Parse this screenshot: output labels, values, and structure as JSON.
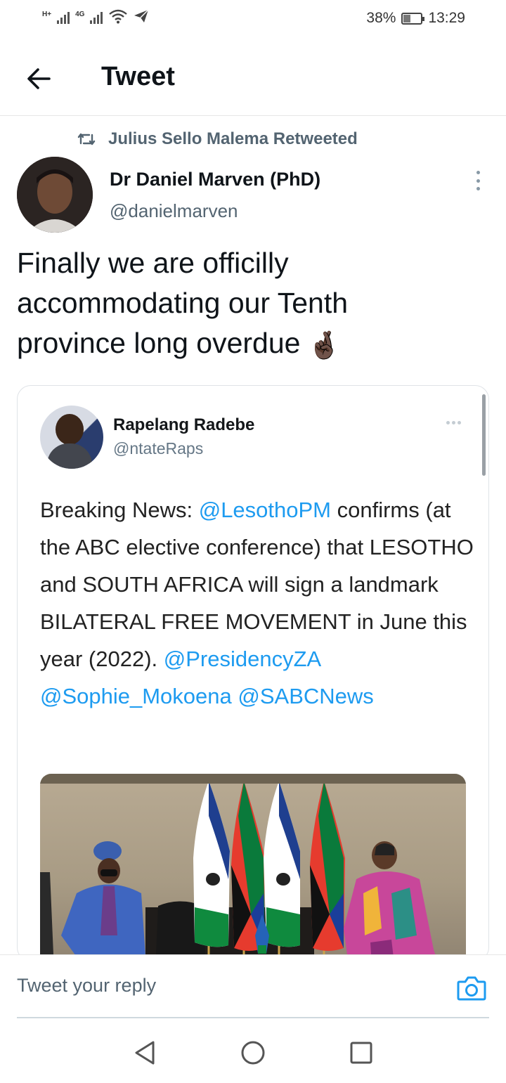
{
  "status_bar": {
    "network_1": "H+",
    "network_2": "4G",
    "battery_percent": "38%",
    "battery_level": 0.38,
    "time": "13:29"
  },
  "header": {
    "title": "Tweet",
    "back_icon": "arrow-left-icon"
  },
  "tweet": {
    "retweeted_by": "Julius Sello Malema Retweeted",
    "author_name": "Dr Daniel Marven (PhD)",
    "author_handle": "@danielmarven",
    "text": "Finally we are officilly accommodating our Tenth province long overdue",
    "emoji": "🤞🏿"
  },
  "quoted_screenshot": {
    "name": "Rapelang Radebe",
    "handle": "@ntateRaps",
    "text_parts": [
      {
        "text": "Breaking News: ",
        "link": false
      },
      {
        "text": "@LesothoPM",
        "link": true
      },
      {
        "text": " confirms (at the ABC elective conference) that LESOTHO and SOUTH AFRICA will sign a landmark BILATERAL FREE MOVEMENT in June this year (2022). ",
        "link": false
      },
      {
        "text": "@PresidencyZA",
        "link": true
      },
      {
        "text": " ",
        "link": false
      },
      {
        "text": "@Sophie_Mokoena",
        "link": true
      },
      {
        "text": " ",
        "link": false
      },
      {
        "text": "@SABCNews",
        "link": true
      }
    ],
    "link_color": "#1d9bf0"
  },
  "reply": {
    "placeholder": "Tweet your reply",
    "camera_icon": "camera-icon"
  },
  "nav": {
    "back": "triangle-back-icon",
    "home": "circle-home-icon",
    "recents": "square-recents-icon"
  },
  "colors": {
    "text_primary": "#0f1419",
    "text_secondary": "#536471",
    "accent": "#1d9bf0"
  }
}
